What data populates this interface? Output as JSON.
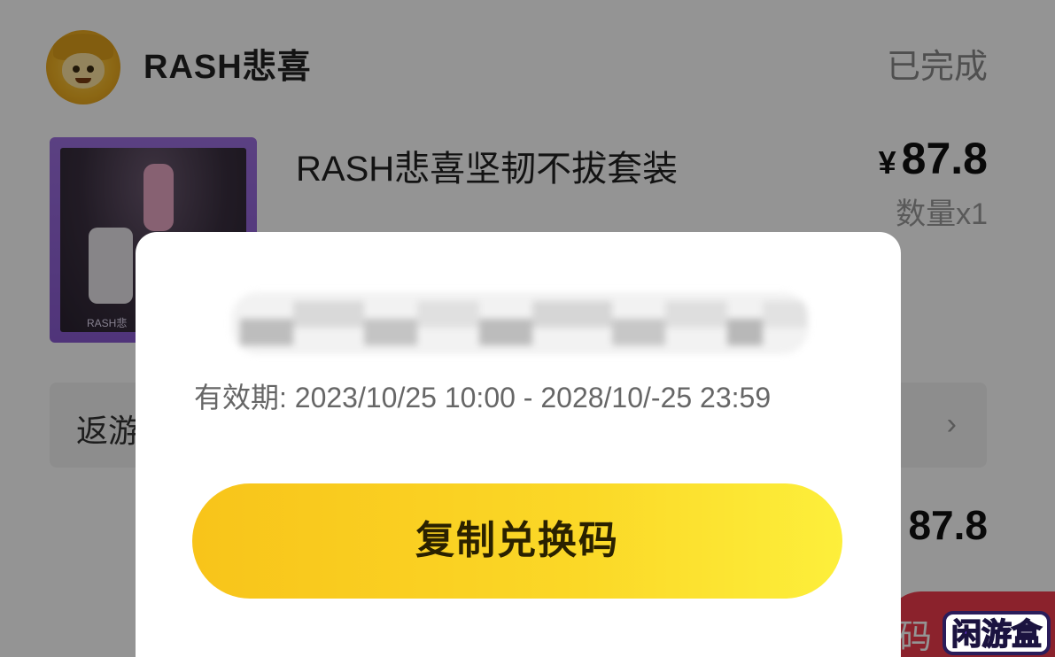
{
  "shop": {
    "name": "RASH悲喜",
    "status": "已完成"
  },
  "product": {
    "title": "RASH悲喜坚韧不拔套装",
    "currency": "¥",
    "price": "87.8",
    "quantity": "数量x1",
    "thumb_caption": "RASH悲"
  },
  "rebate_row": {
    "label": "返游",
    "arrow": "›"
  },
  "order_total": "87.8",
  "bottom_button": {
    "label": "码",
    "color": "#ef3b4c"
  },
  "modal": {
    "validity": "有效期: 2023/10/25 10:00 - 2028/10/-25 23:59",
    "copy_button": "复制兑换码",
    "accent_color": "#fbd827"
  },
  "watermark": {
    "text": "闲游盒"
  }
}
